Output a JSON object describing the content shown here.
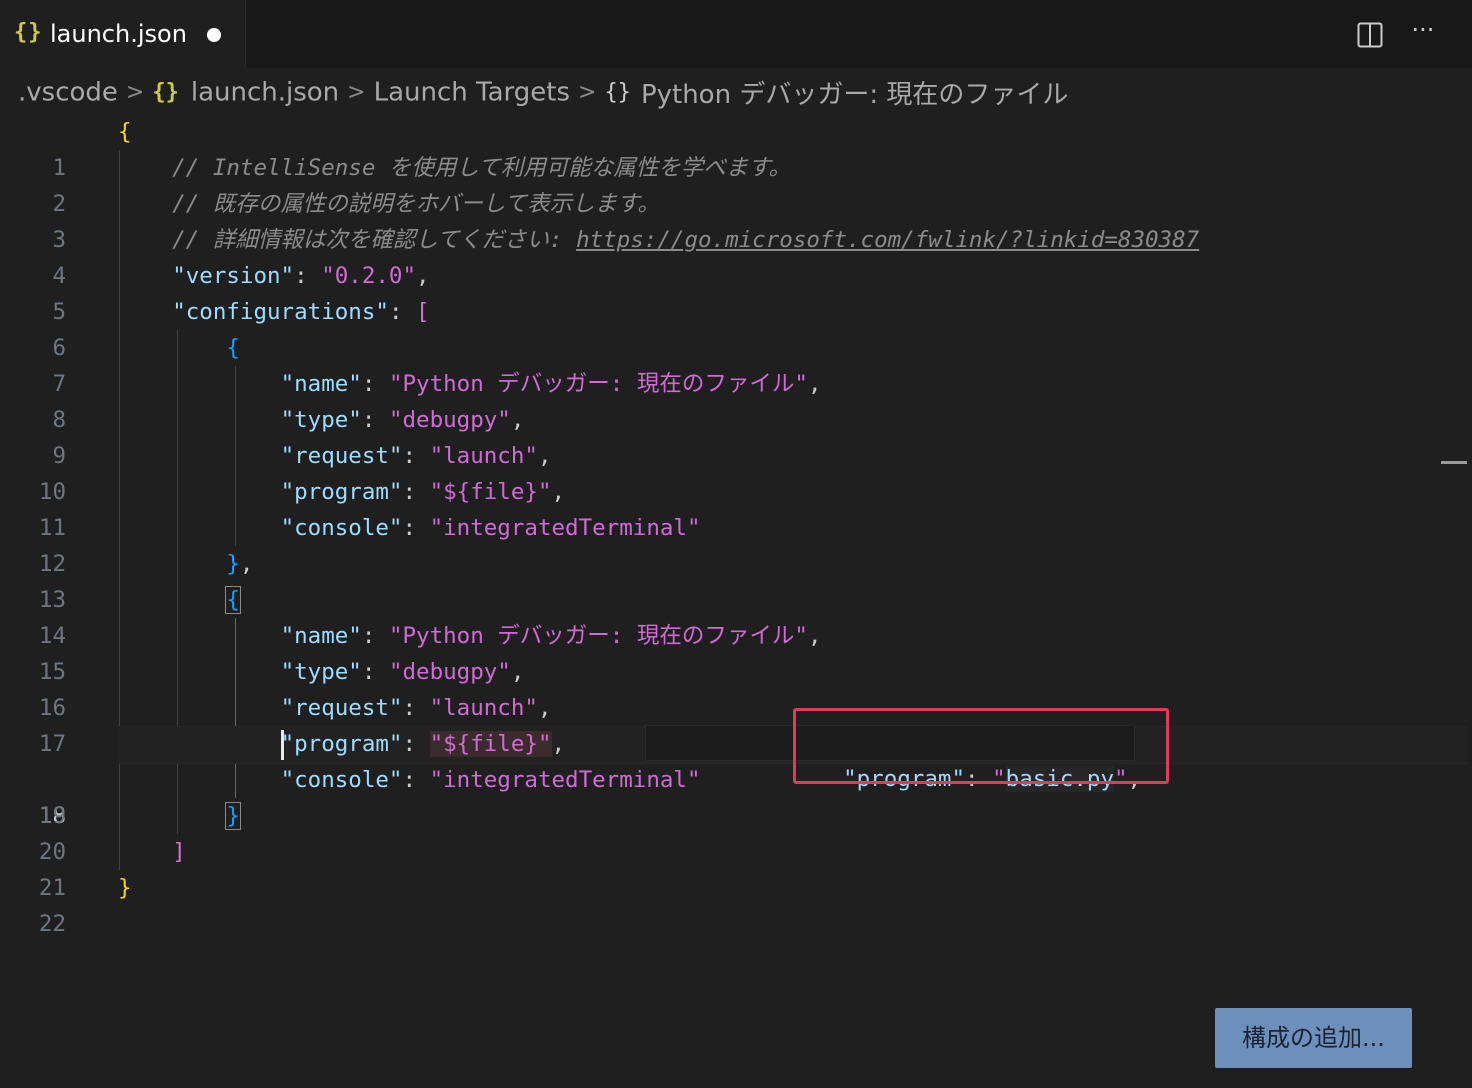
{
  "tab": {
    "label": "launch.json",
    "icon": "json-braces-icon",
    "dirty": true
  },
  "toolbar": {
    "split_icon": "split-editor-icon",
    "more_label": "···"
  },
  "breadcrumb": {
    "items": [
      ".vscode",
      "launch.json",
      "Launch Targets",
      "Python デバッガー: 現在のファイル"
    ]
  },
  "editor": {
    "current_line": 18,
    "line_numbers": [
      "1",
      "2",
      "3",
      "4",
      "5",
      "6",
      "7",
      "8",
      "9",
      "10",
      "11",
      "12",
      "13",
      "14",
      "15",
      "16",
      "17",
      "18",
      "19",
      "20",
      "21",
      "22"
    ],
    "lines": {
      "l2": "// IntelliSense を使用して利用可能な属性を学べます。",
      "l3": "// 既存の属性の説明をホバーして表示します。",
      "l4_text": "// 詳細情報は次を確認してください: ",
      "l4_link": "https://go.microsoft.com/fwlink/?linkid=830387",
      "version_key": "\"version\"",
      "version_val": "\"0.2.0\"",
      "configurations_key": "\"configurations\"",
      "name_key": "\"name\"",
      "name_val": "\"Python デバッガー: 現在のファイル\"",
      "type_key": "\"type\"",
      "type_val": "\"debugpy\"",
      "request_key": "\"request\"",
      "request_val": "\"launch\"",
      "program_key": "\"program\"",
      "program_val": "\"${file}\"",
      "console_key": "\"console\"",
      "console_val": "\"integratedTerminal\""
    },
    "suggestion": {
      "key": "\"program\"",
      "value_open": "\"",
      "value_body": "basic.py",
      "value_close": "\"",
      "trailing": ","
    }
  },
  "add_config_button": {
    "label": "構成の追加..."
  },
  "colors": {
    "background": "#1f1f1f",
    "string": "#ce9178",
    "key": "#9cdcfe",
    "highlight_box": "#e23b5a",
    "button": "#6c8fbb"
  }
}
